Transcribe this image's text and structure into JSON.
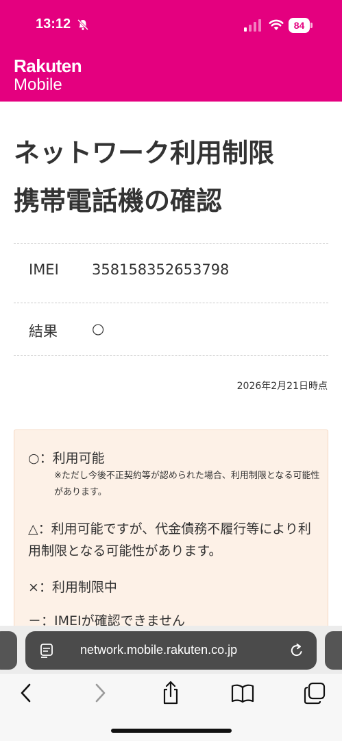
{
  "status_bar": {
    "time": "13:12",
    "battery_level": "84"
  },
  "brand": {
    "line1": "Rakuten",
    "line2": "Mobile",
    "color": "#e4007f"
  },
  "page": {
    "title_line1": "ネットワーク利用制限",
    "title_line2": "携帯電話機の確認",
    "imei_label": "IMEI",
    "imei_value": "358158352653798",
    "result_label": "結果",
    "result_value": "○",
    "timestamp": "2026年2月21日時点"
  },
  "legend": {
    "ok_label": "○：利用可能",
    "ok_note": "※ただし今後不正契約等が認められた場合、利用制限となる可能性があります。",
    "warn_label": "△：利用可能ですが、代金債務不履行等により利用制限となる可能性があります。",
    "ng_label": "×：利用制限中",
    "unknown_label": "－：IMEIが確認できません"
  },
  "browser": {
    "url": "network.mobile.rakuten.co.jp",
    "icons": [
      "reader-icon",
      "reload-icon",
      "back-icon",
      "forward-icon",
      "share-icon",
      "bookmarks-icon",
      "tabs-icon"
    ]
  }
}
